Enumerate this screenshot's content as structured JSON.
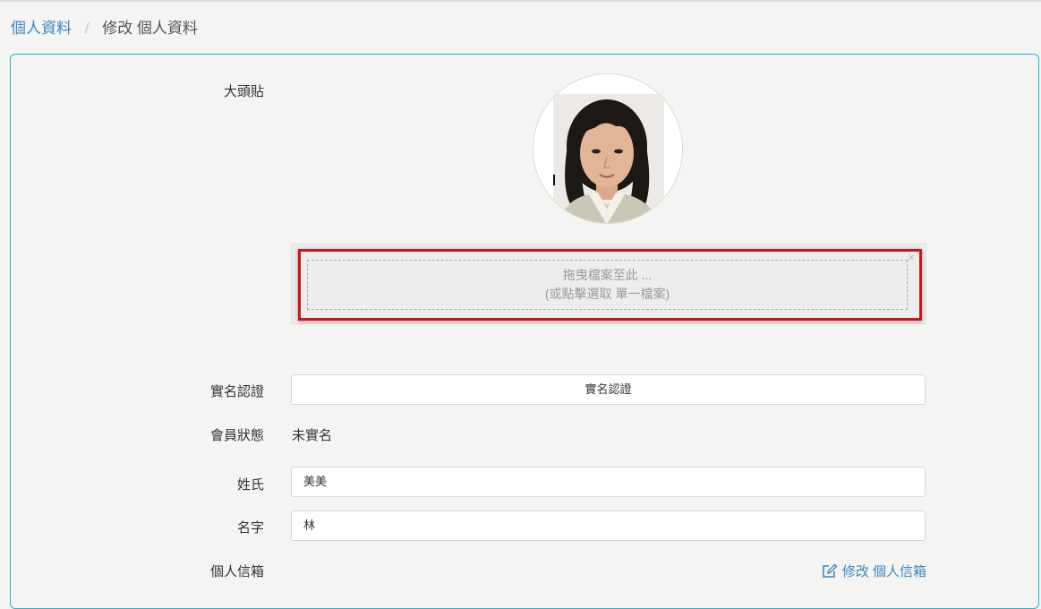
{
  "breadcrumb": {
    "parent": "個人資料",
    "separator": "/",
    "current": "修改 個人資料"
  },
  "form": {
    "avatar_label": "大頭貼",
    "dropzone": {
      "line1": "拖曳檔案至此 ...",
      "line2": "(或點擊選取 單一檔案)",
      "close": "×"
    },
    "verify_label": "實名認證",
    "verify_button": "實名認證",
    "status_label": "會員狀態",
    "status_value": "未實名",
    "surname_label": "姓氏",
    "surname_value": "美美",
    "name_label": "名字",
    "name_value": "林",
    "email_label": "個人信箱",
    "edit_email_link": "修改 個人信箱"
  },
  "colors": {
    "accent": "#28b4c9",
    "link": "#3a87c0",
    "highlight": "#d0131a"
  }
}
